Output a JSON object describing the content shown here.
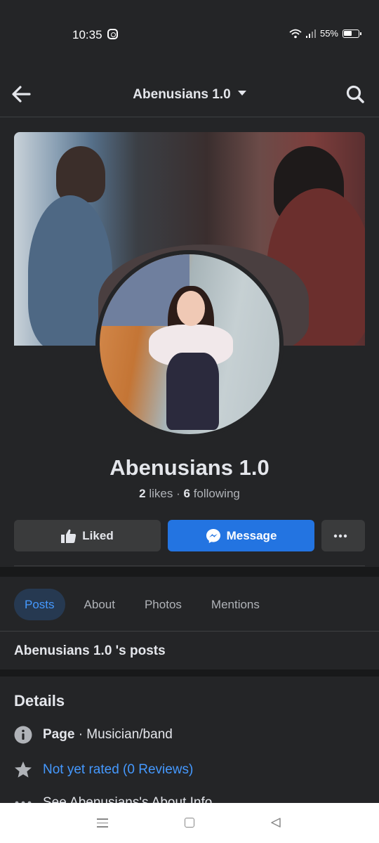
{
  "status_bar": {
    "time": "10:35",
    "battery": "55%"
  },
  "app_bar": {
    "title": "Abenusians 1.0"
  },
  "profile": {
    "name": "Abenusians 1.0",
    "likes_count": "2",
    "likes_label": "likes",
    "separator": "·",
    "following_count": "6",
    "following_label": "following"
  },
  "actions": {
    "liked_label": "Liked",
    "message_label": "Message"
  },
  "tabs": [
    {
      "label": "Posts",
      "active": true
    },
    {
      "label": "About"
    },
    {
      "label": "Photos"
    },
    {
      "label": "Mentions"
    }
  ],
  "posts_heading": "Abenusians 1.0 's posts",
  "details": {
    "title": "Details",
    "page_label": "Page",
    "page_category": "· Musician/band",
    "rating": "Not yet rated (0 Reviews)",
    "about_link": "See Abenusians's About Info"
  },
  "colors": {
    "background": "#242527",
    "accent": "#2374e1",
    "link": "#4599ff",
    "active_tab_bg": "#263951"
  }
}
